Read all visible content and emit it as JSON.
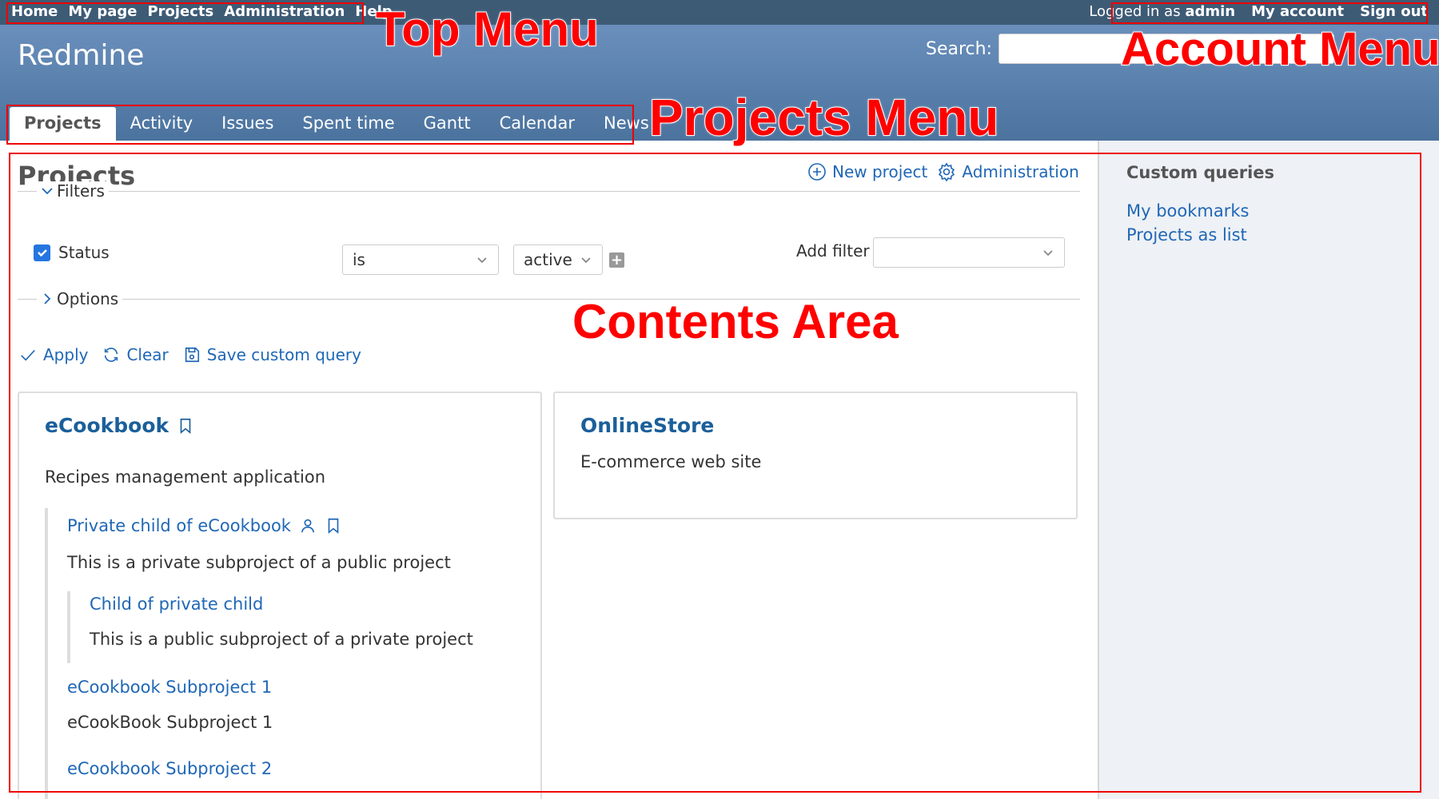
{
  "top_menu": {
    "links": [
      "Home",
      "My page",
      "Projects",
      "Administration",
      "Help"
    ],
    "logged_prefix": "Logged in as",
    "logged_user": "admin",
    "my_account": "My account",
    "sign_out": "Sign out"
  },
  "header": {
    "app_title": "Redmine",
    "search_label": "Search:",
    "search_value": ""
  },
  "main_menu": {
    "tabs": [
      "Projects",
      "Activity",
      "Issues",
      "Spent time",
      "Gantt",
      "Calendar",
      "News"
    ],
    "selected": "Projects"
  },
  "content": {
    "title": "Projects",
    "new_project": "New project",
    "administration": "Administration",
    "filters_legend": "Filters",
    "status_label": "Status",
    "operator_value": "is",
    "status_value": "active",
    "add_filter_label": "Add filter",
    "options_legend": "Options",
    "apply": "Apply",
    "clear": "Clear",
    "save_query": "Save custom query"
  },
  "projects": [
    {
      "name": "eCookbook",
      "description": "Recipes management application",
      "children": [
        {
          "name": "Private child of eCookbook",
          "description": "This is a private subproject of a public project"
        },
        {
          "name": "Child of private child",
          "description": "This is a public subproject of a private project"
        },
        {
          "name": "eCookbook Subproject 1",
          "description": "eCookBook Subproject 1"
        },
        {
          "name": "eCookbook Subproject 2",
          "description": ""
        }
      ]
    },
    {
      "name": "OnlineStore",
      "description": "E-commerce web site"
    }
  ],
  "sidebar": {
    "title": "Custom queries",
    "queries": [
      "My bookmarks",
      "Projects as list"
    ]
  },
  "annotations": {
    "top_menu": "Top Menu",
    "account_menu": "Account Menu",
    "projects_menu": "Projects Menu",
    "contents_area": "Contents Area"
  },
  "colors": {
    "top_menu_bg": "#3e5b76",
    "header_gradient_top": "#6a8fbc",
    "header_gradient_bottom": "#4b739e",
    "link": "#1f67b6",
    "annotation": "#ff0000"
  }
}
